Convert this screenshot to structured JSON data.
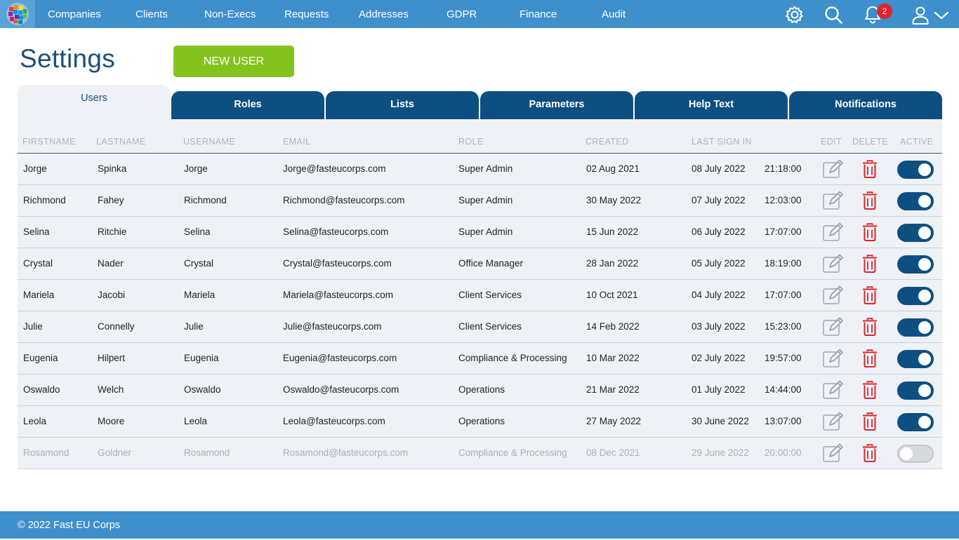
{
  "nav": {
    "items": [
      "Companies",
      "Clients",
      "Non-Execs",
      "Requests",
      "Addresses",
      "GDPR",
      "Finance",
      "Audit"
    ],
    "notification_count": "2",
    "icons": [
      "gear-icon",
      "search-icon",
      "bell-icon",
      "user-icon",
      "chevron-down-icon"
    ]
  },
  "page": {
    "title": "Settings",
    "new_user_label": "NEW USER"
  },
  "tabs": [
    "Users",
    "Roles",
    "Lists",
    "Parameters",
    "Help Text",
    "Notifications"
  ],
  "table": {
    "headers": [
      "FIRSTNAME",
      "LASTNAME",
      "USERNAME",
      "EMAIL",
      "ROLE",
      "CREATED",
      "LAST SIGN IN",
      "EDIT",
      "DELETE",
      "ACTIVE"
    ],
    "rows": [
      {
        "firstname": "Jorge",
        "lastname": "Spinka",
        "username": "Jorge",
        "email": "Jorge@fasteucorps.com",
        "role": "Super Admin",
        "created": "02 Aug 2021",
        "last_sign_in_date": "08 July 2022",
        "last_sign_in_time": "21:18:00",
        "active": true
      },
      {
        "firstname": "Richmond",
        "lastname": "Fahey",
        "username": "Richmond",
        "email": "Richmond@fasteucorps.com",
        "role": "Super Admin",
        "created": "30 May 2022",
        "last_sign_in_date": "07 July 2022",
        "last_sign_in_time": "12:03:00",
        "active": true
      },
      {
        "firstname": "Selina",
        "lastname": "Ritchie",
        "username": "Selina",
        "email": "Selina@fasteucorps.com",
        "role": "Super Admin",
        "created": "15 Jun 2022",
        "last_sign_in_date": "06 July 2022",
        "last_sign_in_time": "17:07:00",
        "active": true
      },
      {
        "firstname": "Crystal",
        "lastname": "Nader",
        "username": "Crystal",
        "email": "Crystal@fasteucorps.com",
        "role": "Office Manager",
        "created": "28 Jan 2022",
        "last_sign_in_date": "05 July 2022",
        "last_sign_in_time": "18:19:00",
        "active": true
      },
      {
        "firstname": "Mariela",
        "lastname": "Jacobi",
        "username": "Mariela",
        "email": "Mariela@fasteucorps.com",
        "role": "Client Services",
        "created": "10 Oct 2021",
        "last_sign_in_date": "04 July 2022",
        "last_sign_in_time": "17:07:00",
        "active": true
      },
      {
        "firstname": "Julie",
        "lastname": "Connelly",
        "username": "Julie",
        "email": "Julie@fasteucorps.com",
        "role": "Client Services",
        "created": "14 Feb 2022",
        "last_sign_in_date": "03 July 2022",
        "last_sign_in_time": "15:23:00",
        "active": true
      },
      {
        "firstname": "Eugenia",
        "lastname": "Hilpert",
        "username": "Eugenia",
        "email": "Eugenia@fasteucorps.com",
        "role": "Compliance & Processing",
        "created": "10 Mar 2022",
        "last_sign_in_date": "02 July 2022",
        "last_sign_in_time": "19:57:00",
        "active": true
      },
      {
        "firstname": "Oswaldo",
        "lastname": "Welch",
        "username": "Oswaldo",
        "email": "Oswaldo@fasteucorps.com",
        "role": "Operations",
        "created": "21 Mar 2022",
        "last_sign_in_date": "01 July 2022",
        "last_sign_in_time": "14:44:00",
        "active": true
      },
      {
        "firstname": "Leola",
        "lastname": "Moore",
        "username": "Leola",
        "email": "Leola@fasteucorps.com",
        "role": "Operations",
        "created": "27 May 2022",
        "last_sign_in_date": "30 June 2022",
        "last_sign_in_time": "13:07:00",
        "active": true
      },
      {
        "firstname": "Rosamond",
        "lastname": "Goldner",
        "username": "Rosamond",
        "email": "Rosamond@fasteucorps.com",
        "role": "Compliance & Processing",
        "created": "08 Dec 2021",
        "last_sign_in_date": "29 June 2022",
        "last_sign_in_time": "20:00:00",
        "active": false
      }
    ]
  },
  "footer": {
    "copyright": "© 2022 Fast EU Corps"
  },
  "colors": {
    "topbar": "#3e8fcc",
    "tab_dark": "#0e4f82",
    "new_user_green": "#84c31e",
    "delete_red": "#d9262c",
    "badge_red": "#e0232a"
  }
}
